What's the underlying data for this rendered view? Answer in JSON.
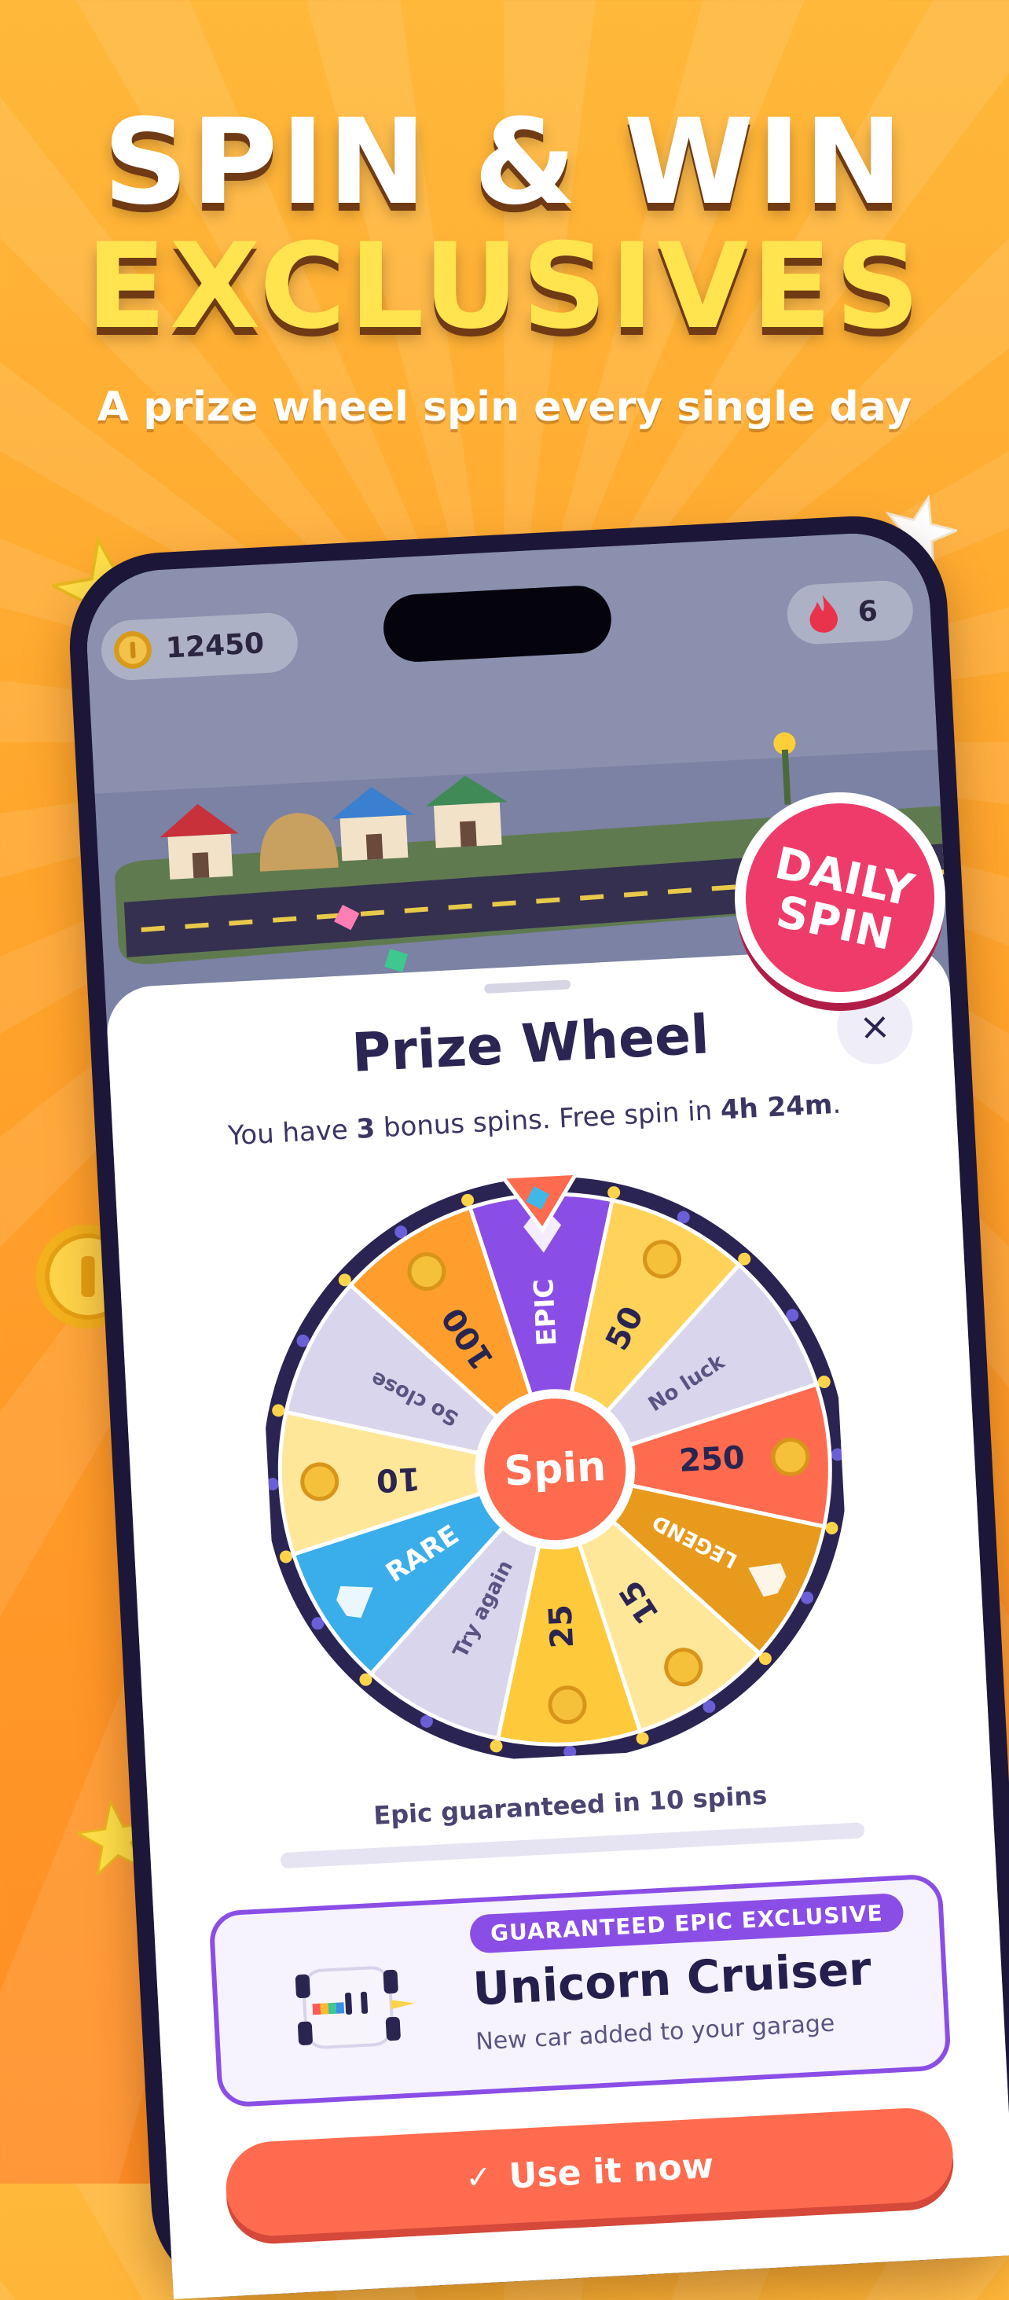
{
  "promo": {
    "headline_line1": "SPIN & WIN",
    "headline_line2": "EXCLUSIVES",
    "subtitle": "A prize wheel spin every single day"
  },
  "status": {
    "coins": "12450",
    "streak": "6"
  },
  "badge": {
    "line1": "DAILY",
    "line2": "SPIN"
  },
  "sheet": {
    "title": "Prize Wheel",
    "subtitle_pre": "You have ",
    "bonus_spins": "3",
    "subtitle_mid": " bonus spins. Free spin in ",
    "free_spin_time": "4h 24m",
    "subtitle_end": ".",
    "close_icon": "×"
  },
  "wheel": {
    "center_label": "Spin",
    "segments": [
      {
        "label": "EPIC",
        "color": "#8a4ee6",
        "text_color": "#ffffff",
        "icon": "diamond-icon"
      },
      {
        "label": "50",
        "color": "#ffd35a",
        "text_color": "#2a2550",
        "icon": "coin-icon"
      },
      {
        "label": "No luck",
        "color": "#d9d5ec",
        "text_color": "#5a5482",
        "icon": ""
      },
      {
        "label": "250",
        "color": "#ff6b4f",
        "text_color": "#2a2550",
        "icon": "coin-icon"
      },
      {
        "label": "LEGEND",
        "color": "#e89a1c",
        "text_color": "#ffffff",
        "icon": "gem-icon"
      },
      {
        "label": "15",
        "color": "#ffe79a",
        "text_color": "#2a2550",
        "icon": "coin-icon"
      },
      {
        "label": "25",
        "color": "#ffc93c",
        "text_color": "#2a2550",
        "icon": "coin-icon"
      },
      {
        "label": "Try again",
        "color": "#d9d5ec",
        "text_color": "#5a5482",
        "icon": ""
      },
      {
        "label": "RARE",
        "color": "#3aaeea",
        "text_color": "#ffffff",
        "icon": "diamond-icon"
      },
      {
        "label": "10",
        "color": "#ffe79a",
        "text_color": "#2a2550",
        "icon": "coin-icon"
      },
      {
        "label": "So close",
        "color": "#d9d5ec",
        "text_color": "#5a5482",
        "icon": ""
      },
      {
        "label": "100",
        "color": "#ff9e2c",
        "text_color": "#2a2550",
        "icon": "coin-icon"
      }
    ]
  },
  "progress": {
    "label_pre": "Epic guaranteed in ",
    "spins_left": "10",
    "label_post": " spins",
    "fraction": 0.0
  },
  "reward": {
    "badge": "GUARANTEED EPIC EXCLUSIVE",
    "title": "Unicorn Cruiser",
    "description": "New car added to your garage"
  },
  "cta": {
    "label": "Use it now",
    "icon": "✓"
  },
  "colors": {
    "accent": "#ff6b4f",
    "purple": "#8a4ee6",
    "badge_red": "#ef3b6a"
  }
}
